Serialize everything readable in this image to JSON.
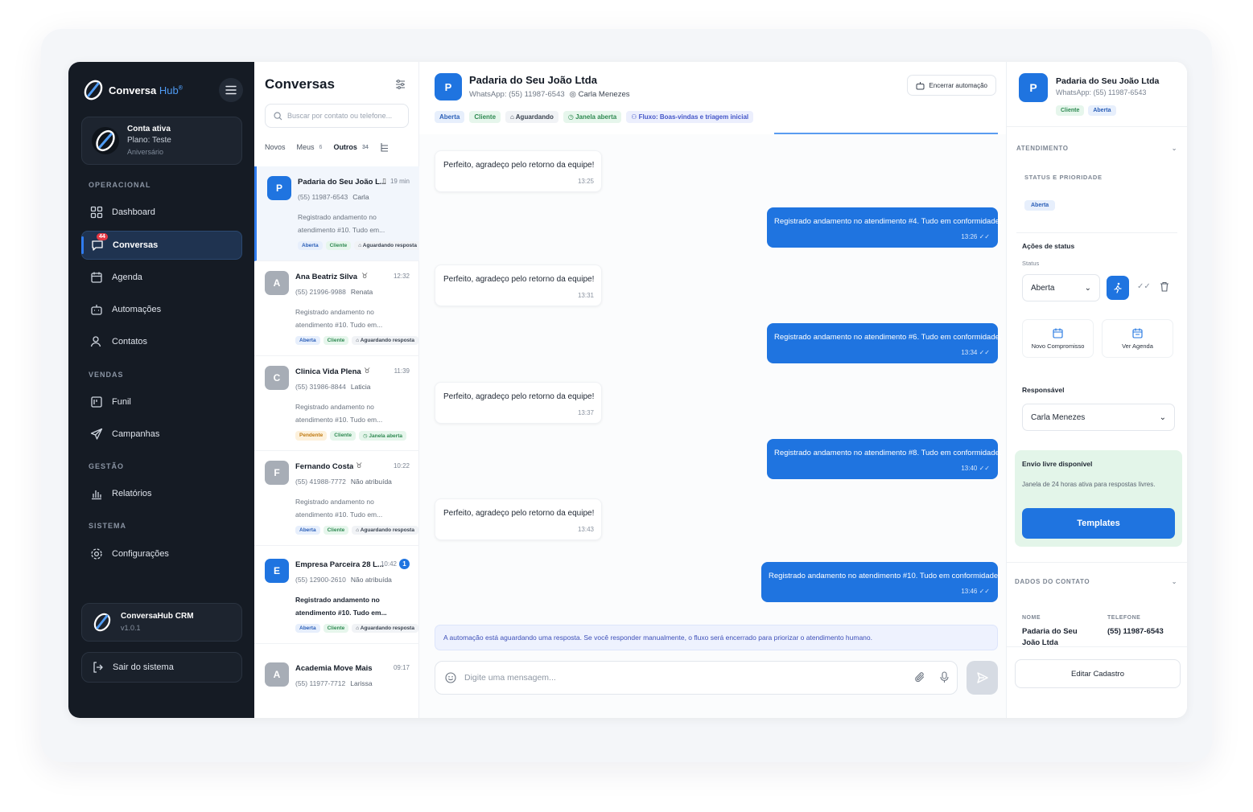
{
  "brand": {
    "name": "Conversa",
    "hub": "Hub",
    "mark": "®"
  },
  "account": {
    "title": "Conta ativa",
    "plan": "Plano: Teste",
    "note": "Aniversário"
  },
  "sections": {
    "operacional": "OPERACIONAL",
    "vendas": "VENDAS",
    "gestao": "GESTÃO",
    "sistema": "SISTEMA"
  },
  "nav": {
    "dashboard": "Dashboard",
    "conversas": "Conversas",
    "conversas_badge": "44",
    "agenda": "Agenda",
    "automacoes": "Automações",
    "contatos": "Contatos",
    "funil": "Funil",
    "campanhas": "Campanhas",
    "relatorios": "Relatórios",
    "configuracoes": "Configurações"
  },
  "crm": {
    "title": "ConversaHub CRM",
    "version": "v1.0.1"
  },
  "logout_label": "Sair do sistema",
  "conv_list": {
    "title": "Conversas",
    "search_placeholder": "Buscar por contato ou telefone...",
    "tabs": [
      {
        "label": "Novos",
        "count": ""
      },
      {
        "label": "Meus",
        "count": "6"
      },
      {
        "label": "Outros",
        "count": "34"
      }
    ],
    "items": [
      {
        "initial": "P",
        "name": "Padaria do Seu João L...",
        "time": "19 min",
        "phone": "(55) 11987-6543",
        "agent": "Carla",
        "preview": "Registrado andamento no atendimento #10. Tudo em...",
        "tags": [
          "Aberta",
          "Cliente",
          "Aguardando resposta"
        ]
      },
      {
        "initial": "A",
        "name": "Ana Beatriz Silva",
        "time": "12:32",
        "phone": "(55) 21996-9988",
        "agent": "Renata",
        "preview": "Registrado andamento no atendimento #10. Tudo em...",
        "tags": [
          "Aberta",
          "Cliente",
          "Aguardando resposta"
        ]
      },
      {
        "initial": "C",
        "name": "Clinica Vida Plena",
        "time": "11:39",
        "phone": "(55) 31986-8844",
        "agent": "Laticia",
        "preview": "Registrado andamento no atendimento #10. Tudo em...",
        "tags": [
          "Pendente",
          "Cliente",
          "Janela aberta"
        ]
      },
      {
        "initial": "F",
        "name": "Fernando Costa",
        "time": "10:22",
        "phone": "(55) 41988-7772",
        "agent": "Não atribuída",
        "preview": "Registrado andamento no atendimento #10. Tudo em...",
        "tags": [
          "Aberta",
          "Cliente",
          "Aguardando resposta"
        ]
      },
      {
        "initial": "E",
        "name": "Empresa Parceira 28 L...",
        "time": "10:42",
        "unread": "1",
        "phone": "(55) 12900-2610",
        "agent": "Não atribuída",
        "preview": "Registrado andamento no atendimento #10. Tudo em...",
        "tags": [
          "Aberta",
          "Cliente",
          "Aguardando resposta"
        ]
      },
      {
        "initial": "A",
        "name": "Academia Move Mais",
        "time": "09:17",
        "phone": "(55) 11977-7712",
        "agent": "Larissa"
      }
    ]
  },
  "chat": {
    "initial": "P",
    "name": "Padaria do Seu João Ltda",
    "whatsapp": "WhatsApp: (55) 11987-6543",
    "agent": "Carla Menezes",
    "end_automation": "Encerrar automação",
    "tags": [
      "Aberta",
      "Cliente",
      "Aguardando",
      "Janela aberta",
      "Fluxo: Boas-vindas e triagem inicial"
    ],
    "messages": [
      {
        "dir": "in",
        "text": "Perfeito, agradeço pelo retorno da equipe!",
        "time": "13:25"
      },
      {
        "dir": "out",
        "text": "Registrado andamento no atendimento #4. Tudo em conformidade.",
        "time": "13:26"
      },
      {
        "dir": "in",
        "text": "Perfeito, agradeço pelo retorno da equipe!",
        "time": "13:31"
      },
      {
        "dir": "out",
        "text": "Registrado andamento no atendimento #6. Tudo em conformidade.",
        "time": "13:34"
      },
      {
        "dir": "in",
        "text": "Perfeito, agradeço pelo retorno da equipe!",
        "time": "13:37"
      },
      {
        "dir": "out",
        "text": "Registrado andamento no atendimento #8. Tudo em conformidade.",
        "time": "13:40"
      },
      {
        "dir": "in",
        "text": "Perfeito, agradeço pelo retorno da equipe!",
        "time": "13:43"
      },
      {
        "dir": "out",
        "text": "Registrado andamento no atendimento #10. Tudo em conformidade.",
        "time": "13:46"
      }
    ],
    "automation_notice": "A automação está aguardando uma resposta. Se você responder manualmente, o fluxo será encerrado para priorizar o atendimento humano.",
    "composer_placeholder": "Digite uma mensagem..."
  },
  "panel": {
    "initial": "P",
    "name": "Padaria do Seu João Ltda",
    "whatsapp": "WhatsApp: (55) 11987-6543",
    "tags": [
      "Cliente",
      "Aberta"
    ],
    "atendimento": "ATENDIMENTO",
    "status_prioridade": "STATUS E PRIORIDADE",
    "status_tag": "Aberta",
    "acoes_status": "Ações de status",
    "status_label": "Status",
    "status_value": "Aberta",
    "novo_compromisso": "Novo Compromisso",
    "ver_agenda": "Ver Agenda",
    "responsavel": "Responsável",
    "responsavel_value": "Carla Menezes",
    "envio_livre": "Envio livre disponível",
    "envio_desc": "Janela de 24 horas ativa para respostas livres.",
    "templates": "Templates",
    "dados_contato": "DADOS DO CONTATO",
    "nome_label": "NOME",
    "nome_value": "Padaria do Seu João Ltda",
    "telefone_label": "TELEFONE",
    "telefone_value": "(55) 11987-6543",
    "editar": "Editar Cadastro"
  },
  "colors": {
    "accent": "#1f74e0",
    "sidebar": "#151b24",
    "success_bg": "#e3f5e9",
    "alert": "#e53945"
  }
}
